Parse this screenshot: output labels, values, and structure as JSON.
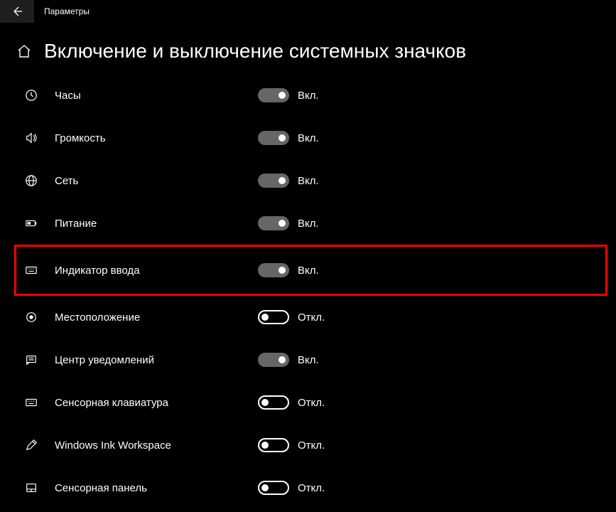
{
  "app_title": "Параметры",
  "page_title": "Включение и выключение системных значков",
  "state_on": "Вкл.",
  "state_off": "Откл.",
  "items": [
    {
      "id": "clock",
      "label": "Часы",
      "on": true,
      "icon": "clock",
      "highlight": false
    },
    {
      "id": "volume",
      "label": "Громкость",
      "on": true,
      "icon": "volume",
      "highlight": false
    },
    {
      "id": "network",
      "label": "Сеть",
      "on": true,
      "icon": "globe",
      "highlight": false
    },
    {
      "id": "power",
      "label": "Питание",
      "on": true,
      "icon": "battery",
      "highlight": false
    },
    {
      "id": "input-indicator",
      "label": "Индикатор ввода",
      "on": true,
      "icon": "keyboard",
      "highlight": true
    },
    {
      "id": "location",
      "label": "Местоположение",
      "on": false,
      "icon": "location",
      "highlight": false
    },
    {
      "id": "action-center",
      "label": "Центр уведомлений",
      "on": true,
      "icon": "notification",
      "highlight": false
    },
    {
      "id": "touch-keyboard",
      "label": "Сенсорная клавиатура",
      "on": false,
      "icon": "keyboard",
      "highlight": false
    },
    {
      "id": "windows-ink",
      "label": "Windows Ink Workspace",
      "on": false,
      "icon": "pen",
      "highlight": false
    },
    {
      "id": "touchpad",
      "label": "Сенсорная панель",
      "on": false,
      "icon": "touchpad",
      "highlight": false
    }
  ]
}
